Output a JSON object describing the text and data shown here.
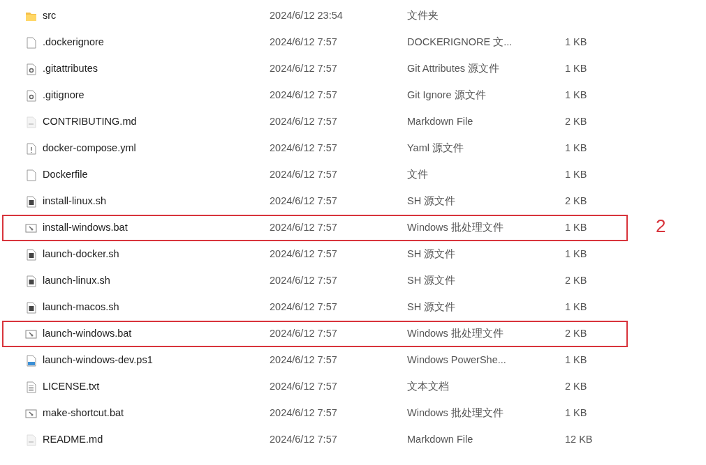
{
  "files": [
    {
      "name": "src",
      "modified": "2024/6/12 23:54",
      "type": "文件夹",
      "kind": "folder",
      "highlighted": false
    },
    {
      "name": ".dockerignore",
      "modified": "2024/6/12 7:57",
      "type": "DOCKERIGNORE 文...",
      "size": "1 KB",
      "kind": "blank",
      "highlighted": false
    },
    {
      "name": ".gitattributes",
      "modified": "2024/6/12 7:57",
      "type": "Git Attributes 源文件",
      "size": "1 KB",
      "kind": "gear",
      "highlighted": false
    },
    {
      "name": ".gitignore",
      "modified": "2024/6/12 7:57",
      "type": "Git Ignore 源文件",
      "size": "1 KB",
      "kind": "gear",
      "highlighted": false
    },
    {
      "name": "CONTRIBUTING.md",
      "modified": "2024/6/12 7:57",
      "type": "Markdown File",
      "size": "2 KB",
      "kind": "markdown",
      "highlighted": false
    },
    {
      "name": "docker-compose.yml",
      "modified": "2024/6/12 7:57",
      "type": "Yaml 源文件",
      "size": "1 KB",
      "kind": "yaml",
      "highlighted": false
    },
    {
      "name": "Dockerfile",
      "modified": "2024/6/12 7:57",
      "type": "文件",
      "size": "1 KB",
      "kind": "blank",
      "highlighted": false
    },
    {
      "name": "install-linux.sh",
      "modified": "2024/6/12 7:57",
      "type": "SH 源文件",
      "size": "2 KB",
      "kind": "shell",
      "highlighted": false
    },
    {
      "name": "install-windows.bat",
      "modified": "2024/6/12 7:57",
      "type": "Windows 批处理文件",
      "size": "1 KB",
      "kind": "batch",
      "highlighted": true,
      "annotation": "2"
    },
    {
      "name": "launch-docker.sh",
      "modified": "2024/6/12 7:57",
      "type": "SH 源文件",
      "size": "1 KB",
      "kind": "shell",
      "highlighted": false
    },
    {
      "name": "launch-linux.sh",
      "modified": "2024/6/12 7:57",
      "type": "SH 源文件",
      "size": "2 KB",
      "kind": "shell",
      "highlighted": false
    },
    {
      "name": "launch-macos.sh",
      "modified": "2024/6/12 7:57",
      "type": "SH 源文件",
      "size": "1 KB",
      "kind": "shell",
      "highlighted": false
    },
    {
      "name": "launch-windows.bat",
      "modified": "2024/6/12 7:57",
      "type": "Windows 批处理文件",
      "size": "2 KB",
      "kind": "batch",
      "highlighted": true
    },
    {
      "name": "launch-windows-dev.ps1",
      "modified": "2024/6/12 7:57",
      "type": "Windows PowerShe...",
      "size": "1 KB",
      "kind": "powershell",
      "highlighted": false
    },
    {
      "name": "LICENSE.txt",
      "modified": "2024/6/12 7:57",
      "type": "文本文档",
      "size": "2 KB",
      "kind": "text",
      "highlighted": false
    },
    {
      "name": "make-shortcut.bat",
      "modified": "2024/6/12 7:57",
      "type": "Windows 批处理文件",
      "size": "1 KB",
      "kind": "batch",
      "highlighted": false
    },
    {
      "name": "README.md",
      "modified": "2024/6/12 7:57",
      "type": "Markdown File",
      "size": "12 KB",
      "kind": "markdown",
      "highlighted": false
    }
  ]
}
